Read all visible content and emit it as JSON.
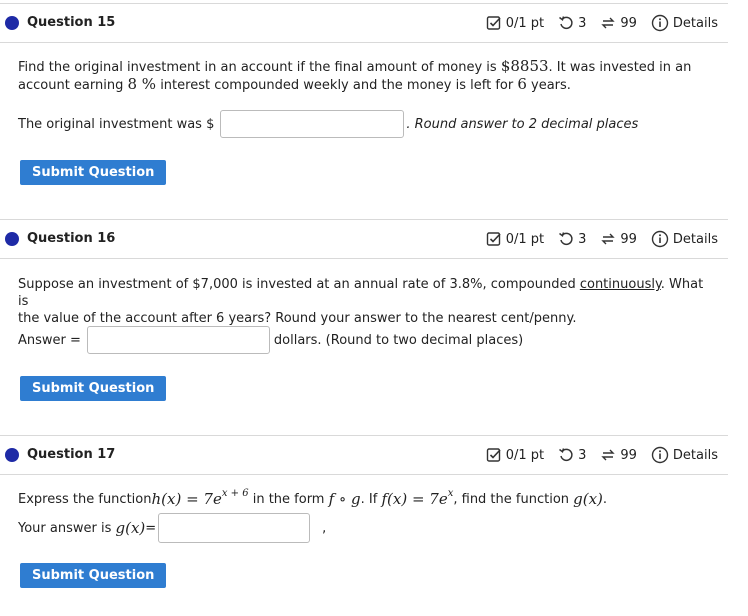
{
  "questions": [
    {
      "title": "Question 15",
      "score": "0/1 pt",
      "tries": "3",
      "attempts": "99",
      "details": "Details",
      "text_a": "Find the original investment in an account if the final amount of money is ",
      "amount": "$8853",
      "text_b": ". It was invested in an",
      "text_c": "account earning ",
      "rate": "8 %",
      "text_d": " interest compounded weekly and the money is left for ",
      "years": "6",
      "text_e": " years.",
      "prompt": "The original investment was $",
      "input_value": "",
      "suffix": ". Round answer to 2 decimal places",
      "submit": "Submit Question"
    },
    {
      "title": "Question 16",
      "score": "0/1 pt",
      "tries": "3",
      "attempts": "99",
      "details": "Details",
      "text_a": "Suppose an investment of $7,000 is invested at an annual rate of 3.8%, compounded ",
      "link": "continuously",
      "text_b": ". What is",
      "text_c": "the value of the account after 6 years? Round your answer to the nearest cent/penny.",
      "prompt": "Answer =",
      "input_value": "",
      "suffix": "dollars. (Round to two decimal places)",
      "submit": "Submit Question"
    },
    {
      "title": "Question 17",
      "score": "0/1 pt",
      "tries": "3",
      "attempts": "99",
      "details": "Details",
      "text_a": "Express the function ",
      "h_expr": "h(x)",
      "eq1": " = 7e",
      "h_exp": "x + 6",
      "text_b": " in the form ",
      "fog": "f ∘ g",
      "text_c": ". If ",
      "f_expr": "f(x)",
      "eq2": " = 7e",
      "f_exp": "x",
      "text_d": ", find the function ",
      "g_expr": "g(x)",
      "text_e": ".",
      "prompt_a": "Your answer is ",
      "prompt_g": "g(x)",
      "prompt_b": "=",
      "input_value": "",
      "trailing": ",",
      "submit": "Submit Question"
    }
  ],
  "colors": {
    "dot": "#1e2aa6",
    "button": "#2f7dd1",
    "border": "#d9d9d9"
  },
  "icons": [
    "checkbox-score-icon",
    "retry-icon",
    "attempts-icon",
    "info-icon"
  ]
}
